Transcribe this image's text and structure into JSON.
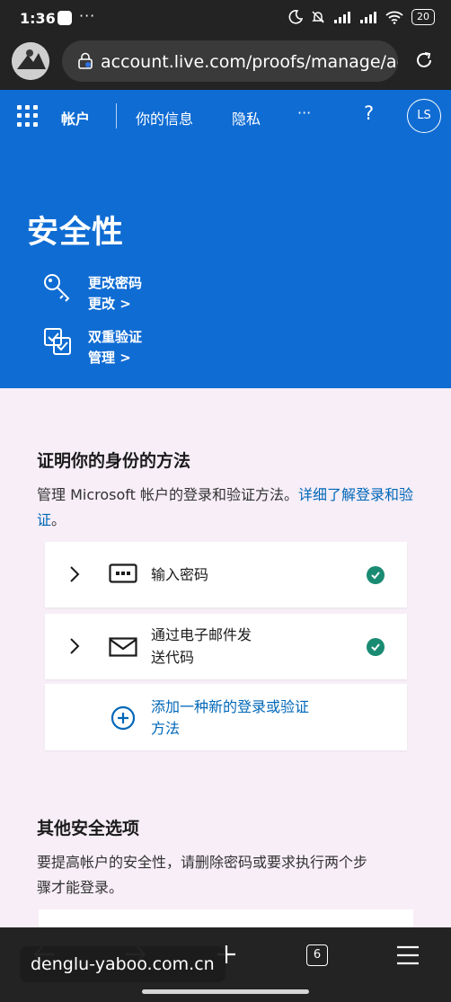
{
  "status_bar": {
    "time": "1:36",
    "dots": "···",
    "battery": "20"
  },
  "browser": {
    "url": "account.live.com/proofs/manage/additional"
  },
  "nav": {
    "account": "帐户",
    "your_info": "你的信息",
    "privacy": "隐私",
    "more": "···",
    "help": "?",
    "avatar_initials": "LS"
  },
  "header": {
    "title": "安全性",
    "items": [
      {
        "label": "更改密码",
        "action": "更改 >",
        "icon": "key-icon"
      },
      {
        "label": "双重验证",
        "action": "管理 >",
        "icon": "checkbox-icon"
      }
    ]
  },
  "proofs": {
    "title": "证明你的身份的方法",
    "desc": "管理 Microsoft 帐户的登录和验证方法。",
    "desc_link": "详细了解登录和验证",
    "desc_end": "。",
    "methods": [
      {
        "line1": "输入密码",
        "line2": "",
        "icon": "password-icon",
        "verified": true
      },
      {
        "line1": "通过电子邮件发",
        "line2": "送代码",
        "icon": "email-icon",
        "verified": true
      }
    ],
    "add": {
      "line1": "添加一种新的登录或验证",
      "line2": "方法"
    }
  },
  "other": {
    "title": "其他安全选项",
    "desc_line1": "要提高帐户的安全性，请删除密码或要求执行两个步",
    "desc_line2": "骤才能登录。"
  },
  "bottom": {
    "tab_count": "6"
  },
  "watermark": "denglu-yaboo.com.cn",
  "colors": {
    "brand_blue": "#0f6cd3",
    "link": "#0067b8",
    "success": "#1a8b73",
    "page_bg": "#f7eef7"
  }
}
